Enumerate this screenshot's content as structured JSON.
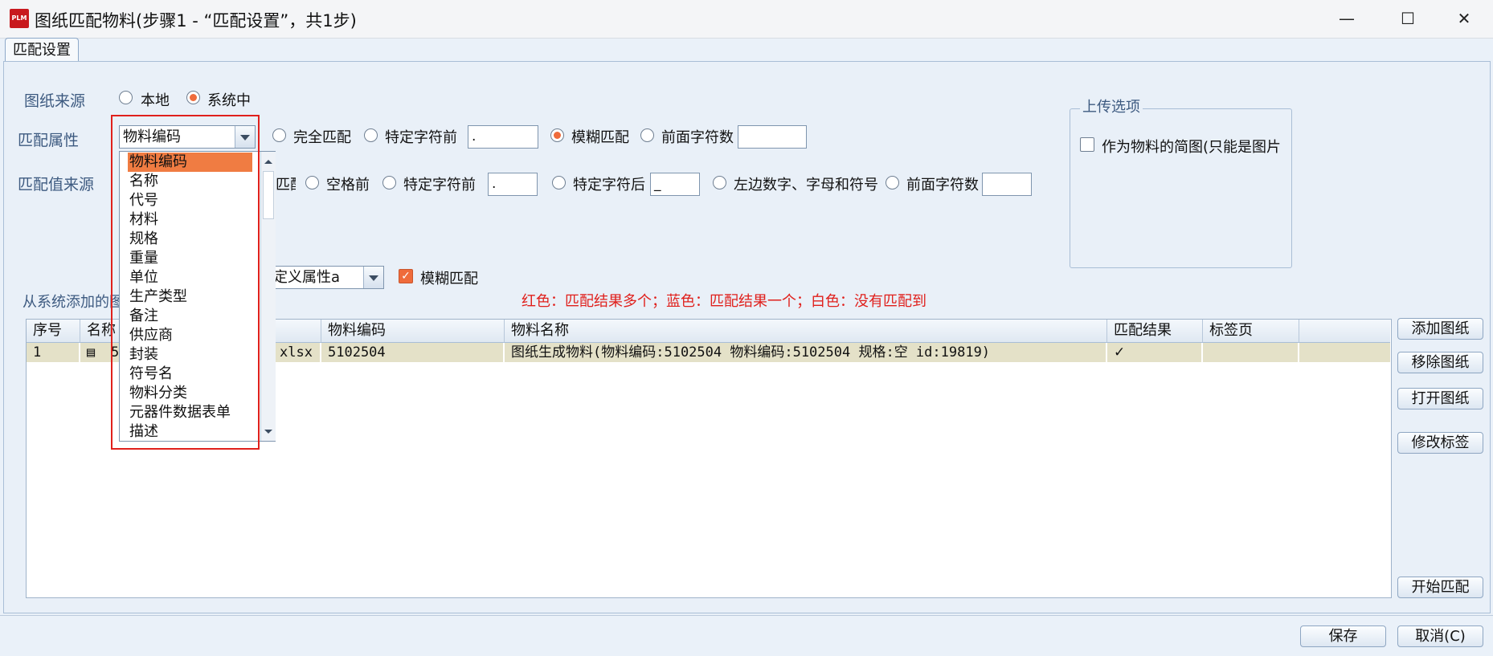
{
  "window": {
    "title": "图纸匹配物料(步骤1 - “匹配设置”，共1步)",
    "app_icon_text": "PLM",
    "minimize": "—",
    "maximize": "☐",
    "close": "✕"
  },
  "tabs": [
    {
      "label": "匹配设置"
    }
  ],
  "source": {
    "label": "图纸来源",
    "options": [
      {
        "label": "本地",
        "checked": false
      },
      {
        "label": "系统中",
        "checked": true
      }
    ]
  },
  "match_attr": {
    "label": "匹配属性",
    "selected": "物料编码",
    "opt_full": "完全匹配",
    "opt_before_char": "特定字符前",
    "before_char_value": ".",
    "opt_fuzzy": "模糊匹配",
    "opt_prefix_len": "前面字符数",
    "prefix_len_value": ""
  },
  "match_value_source": {
    "label": "匹配值来源",
    "opt_full_partial": "匹配",
    "opt_space_before": "空格前",
    "opt_before_char": "特定字符前",
    "before_char_value": ".",
    "opt_after_char": "特定字符后",
    "after_char_value": "_",
    "opt_left_digits": "左边数字、字母和符号",
    "opt_prefix_len": "前面字符数",
    "prefix_len_value": ""
  },
  "custom_attr": {
    "combo_value": "定义属性a",
    "fuzzy_label": "模糊匹配",
    "fuzzy_checked": true
  },
  "added_from_system_label": "从系统添加的图",
  "legend_note": "红色：匹配结果多个；蓝色：匹配结果一个；白色：没有匹配到",
  "upload_options": {
    "title": "上传选项",
    "thumbnail_label": "作为物料的简图(只能是图片",
    "thumbnail_checked": false
  },
  "dropdown": {
    "items": [
      "物料编码",
      "名称",
      "代号",
      "材料",
      "规格",
      "重量",
      "单位",
      "生产类型",
      "备注",
      "供应商",
      "封装",
      "符号名",
      "物料分类",
      "元器件数据表单",
      "描述"
    ],
    "selected_index": 0
  },
  "table": {
    "columns": [
      "序号",
      "名称",
      "物料编码",
      "物料名称",
      "匹配结果",
      "标签页"
    ],
    "rows": [
      {
        "index": "1",
        "name_visible": "5",
        "name_ext": "xlsx",
        "code": "5102504",
        "material_name": "图纸生成物料(物料编码:5102504 物料编码:5102504 规格:空 id:19819)",
        "result": "✓",
        "tab_page": ""
      }
    ]
  },
  "side_buttons": {
    "add": "添加图纸",
    "remove": "移除图纸",
    "open": "打开图纸",
    "edit_tag": "修改标签",
    "start_match": "开始匹配"
  },
  "footer": {
    "save": "保存",
    "cancel": "取消(C)"
  },
  "colors": {
    "accent": "#ef6b3b",
    "label_blue": "#3d5a80",
    "note_red": "#e0201c",
    "row_bg": "#e4e1c8"
  }
}
